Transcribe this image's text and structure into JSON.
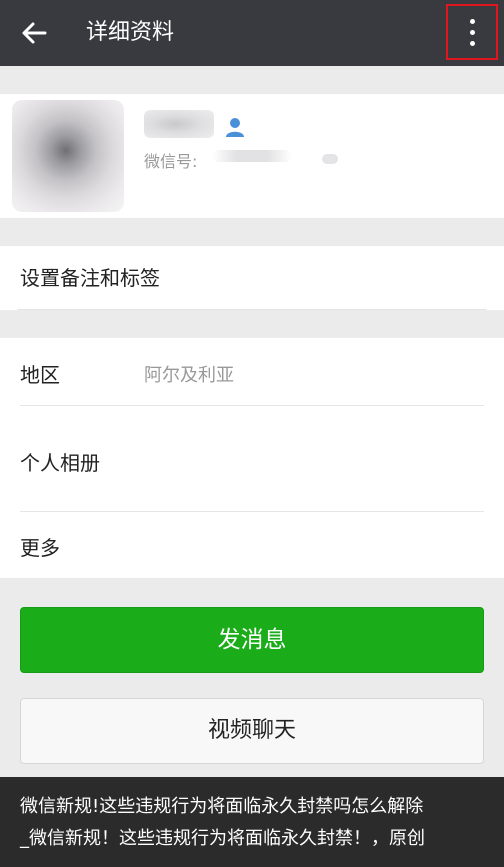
{
  "header": {
    "title": "详细资料",
    "back_icon": "arrow-left-icon",
    "more_icon": "more-vertical-icon",
    "highlight_color": "#e0151e"
  },
  "profile": {
    "wechat_id_label": "微信号:",
    "gender_icon": "person-icon",
    "gender_color": "#4a90d9"
  },
  "remarks": {
    "label": "设置备注和标签"
  },
  "info": {
    "region_label": "地区",
    "region_value": "阿尔及利亚",
    "album_label": "个人相册",
    "more_label": "更多"
  },
  "actions": {
    "send_message": "发消息",
    "video_chat": "视频聊天",
    "primary_color": "#1aad19"
  },
  "caption": {
    "line1": "微信新规!这些违规行为将面临永久封禁吗怎么解除",
    "line2": "_微信新规！这些违规行为将面临永久封禁！，原创"
  }
}
